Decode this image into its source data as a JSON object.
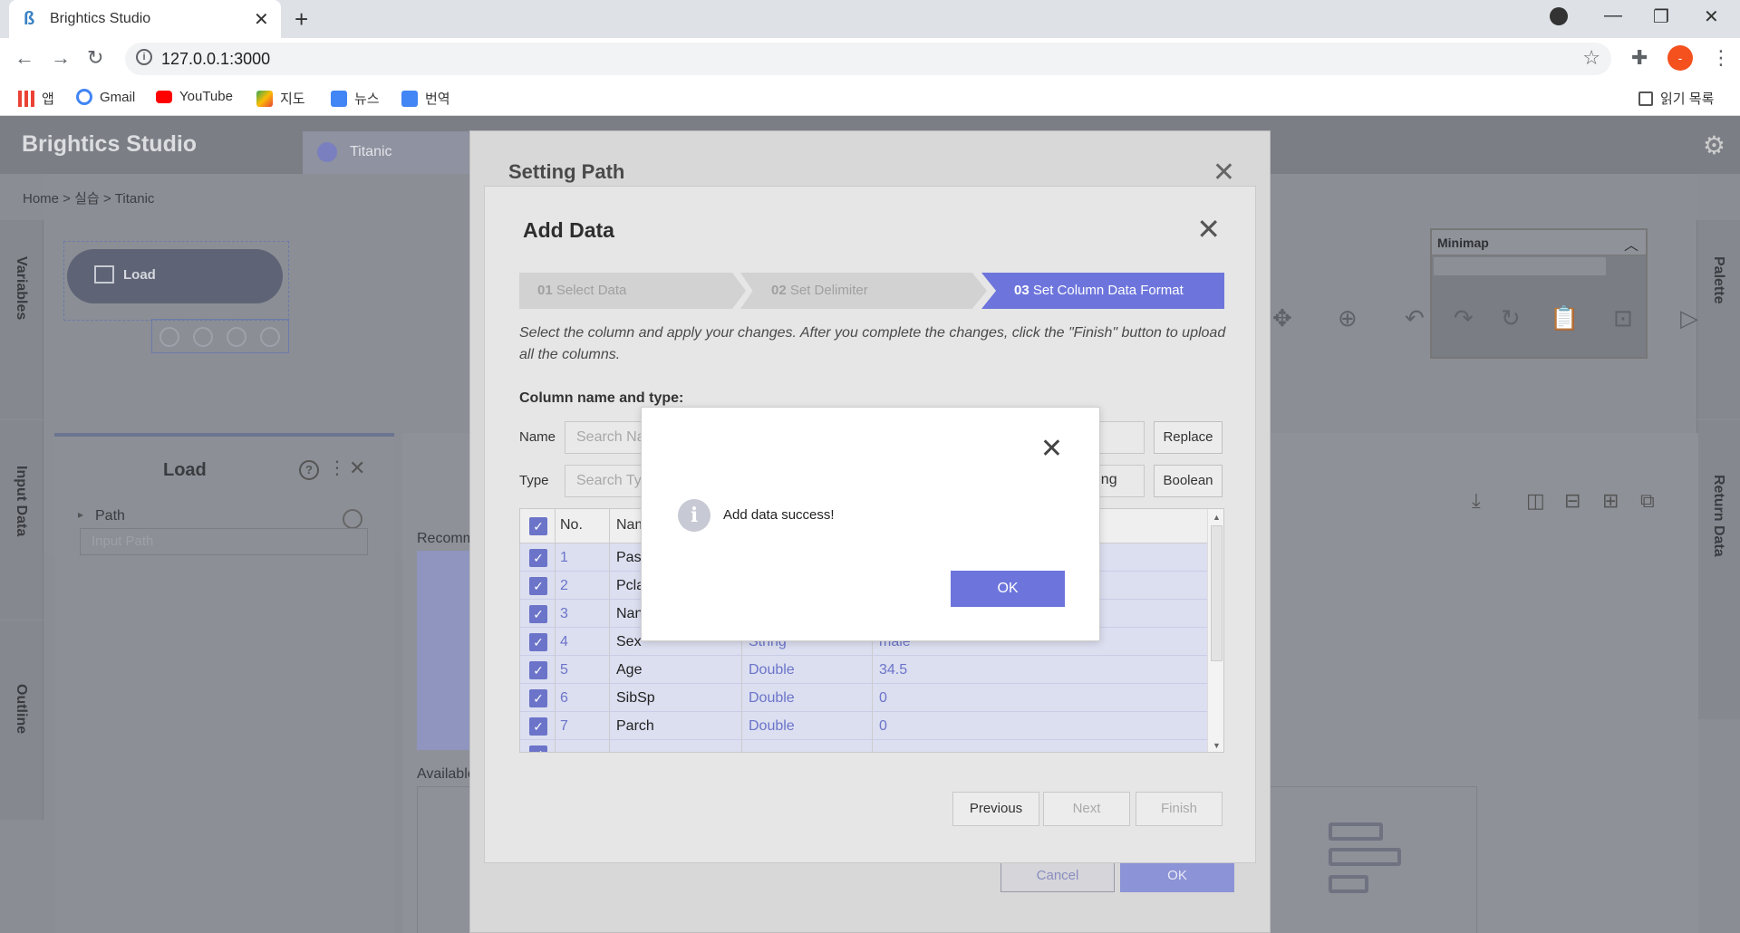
{
  "browser": {
    "tab_title": "Brightics Studio",
    "url": "127.0.0.1:3000",
    "profile_initial": "-",
    "bookmarks": [
      {
        "label": "앱"
      },
      {
        "label": "Gmail"
      },
      {
        "label": "YouTube"
      },
      {
        "label": "지도"
      },
      {
        "label": "뉴스"
      },
      {
        "label": "번역"
      }
    ],
    "reading_list": "읽기 목록"
  },
  "app": {
    "brand": "Brightics Studio",
    "project_tab": "Titanic",
    "breadcrumb": "Home > 실습 > Titanic",
    "left_rail": [
      "Variables",
      "Input Data",
      "Outline"
    ],
    "right_rail": [
      "Palette",
      "Return Data"
    ],
    "node_label": "Load",
    "panel_title": "Load",
    "panel_path_label": "Path",
    "panel_path_placeholder": "Input Path",
    "recommend_label": "Recomm",
    "available_label": "Available",
    "minimap_title": "Minimap"
  },
  "setting_path": {
    "title": "Setting Path",
    "cancel": "Cancel",
    "ok": "OK"
  },
  "add_data": {
    "title": "Add Data",
    "steps": [
      {
        "num": "01",
        "label": "Select Data",
        "active": false
      },
      {
        "num": "02",
        "label": "Set Delimiter",
        "active": false
      },
      {
        "num": "03",
        "label": "Set Column Data Format",
        "active": true
      }
    ],
    "description": "Select the column and apply your changes. After you complete the changes, click the \"Finish\" button to upload all the columns.",
    "section_title": "Column name and type:",
    "name_label": "Name",
    "name_placeholder": "Search Na",
    "type_label": "Type",
    "type_placeholder": "Search Ty",
    "replace_button": "Replace",
    "long_button": "Long",
    "boolean_button": "Boolean",
    "grid_headers": {
      "no": "No.",
      "name": "Nam"
    },
    "rows": [
      {
        "no": "1",
        "name": "Pas",
        "type": "",
        "value": ""
      },
      {
        "no": "2",
        "name": "Pcla",
        "type": "",
        "value": ""
      },
      {
        "no": "3",
        "name": "Nan",
        "type": "",
        "value": ""
      },
      {
        "no": "4",
        "name": "Sex",
        "type": "String",
        "value": "male"
      },
      {
        "no": "5",
        "name": "Age",
        "type": "Double",
        "value": "34.5"
      },
      {
        "no": "6",
        "name": "SibSp",
        "type": "Double",
        "value": "0"
      },
      {
        "no": "7",
        "name": "Parch",
        "type": "Double",
        "value": "0"
      }
    ],
    "previous": "Previous",
    "next": "Next",
    "finish": "Finish"
  },
  "alert": {
    "message": "Add data success!",
    "ok": "OK"
  },
  "colors": {
    "accent": "#6d75dc",
    "checkbox": "#6b74c9",
    "step_active": "#6d75dc",
    "link_text": "#6b74c9"
  }
}
